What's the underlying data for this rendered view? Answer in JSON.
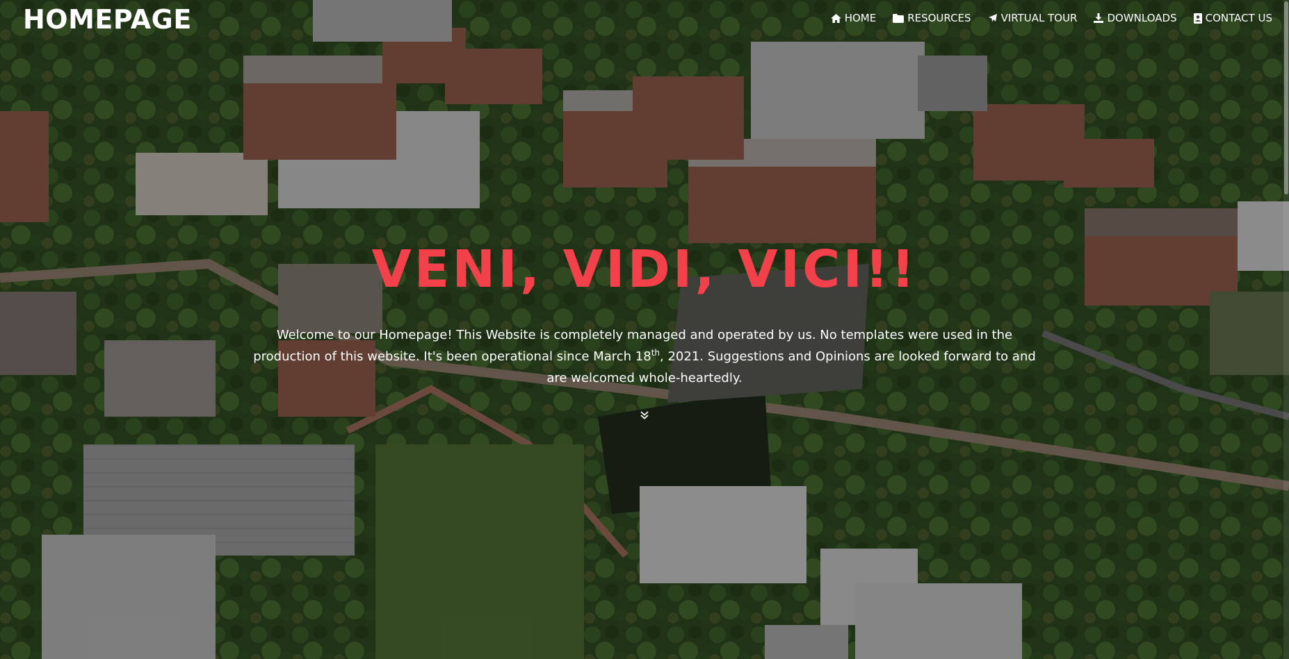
{
  "brand": {
    "title": "HOMEPAGE"
  },
  "nav": {
    "items": [
      {
        "label": "HOME",
        "icon": "home-icon"
      },
      {
        "label": "RESOURCES",
        "icon": "folder-icon"
      },
      {
        "label": "VIRTUAL TOUR",
        "icon": "plane-icon"
      },
      {
        "label": "DOWNLOADS",
        "icon": "download-icon"
      },
      {
        "label": "CONTACT US",
        "icon": "contact-card-icon"
      }
    ]
  },
  "hero": {
    "headline": "VENI, VIDI, VICI!!",
    "welcome_part1": "Welcome to our Homepage! This Website is completely managed and operated by us. No templates were used in the production of this website. It's been operational since March 18",
    "welcome_sup": "th",
    "welcome_part2": ", 2021. Suggestions and Opinions are looked forward to and are welcomed whole-heartedly.",
    "scroll_icon": "chevron-double-down-icon",
    "background": "aerial-campus-photo",
    "headline_color": "#f2414a"
  }
}
